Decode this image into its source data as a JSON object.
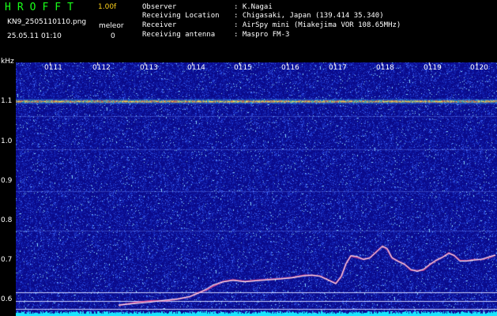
{
  "header": {
    "app_title": "HROFFT",
    "version": "1.00f",
    "filename": "KN9_2505110110.png",
    "timestamp": "25.05.11 01:10",
    "meleor_label": "meleor",
    "meleor_count": "0"
  },
  "metadata": [
    {
      "key": "Observer",
      "value": ": K.Nagai"
    },
    {
      "key": "Receiving Location",
      "value": ": Chigasaki, Japan (139.414 35.340)"
    },
    {
      "key": "Receiver",
      "value": ": AirSpy mini (Miakejima VOR 108.65MHz)"
    },
    {
      "key": "Receiving antenna",
      "value": ": Maspro FM-3"
    }
  ],
  "spectrogram": {
    "y_unit": "kHz",
    "y_ticks": [
      "1.1",
      "1.0",
      "0.9",
      "0.8",
      "0.7",
      "0.6"
    ],
    "time_ticks": [
      "0111",
      "0112",
      "0113",
      "0114",
      "0115",
      "0116",
      "0117",
      "0118",
      "0119",
      "0120"
    ],
    "colors": {
      "background": "#0a0a8a",
      "noise_bright": "#4a6cff",
      "carrier_line": "#ff6a3a",
      "trace": "#ffffff",
      "baseline": "#19e6ff",
      "tick_label": "#ffffff",
      "header_title": "#19ff19",
      "version": "#ffd21a"
    }
  }
}
